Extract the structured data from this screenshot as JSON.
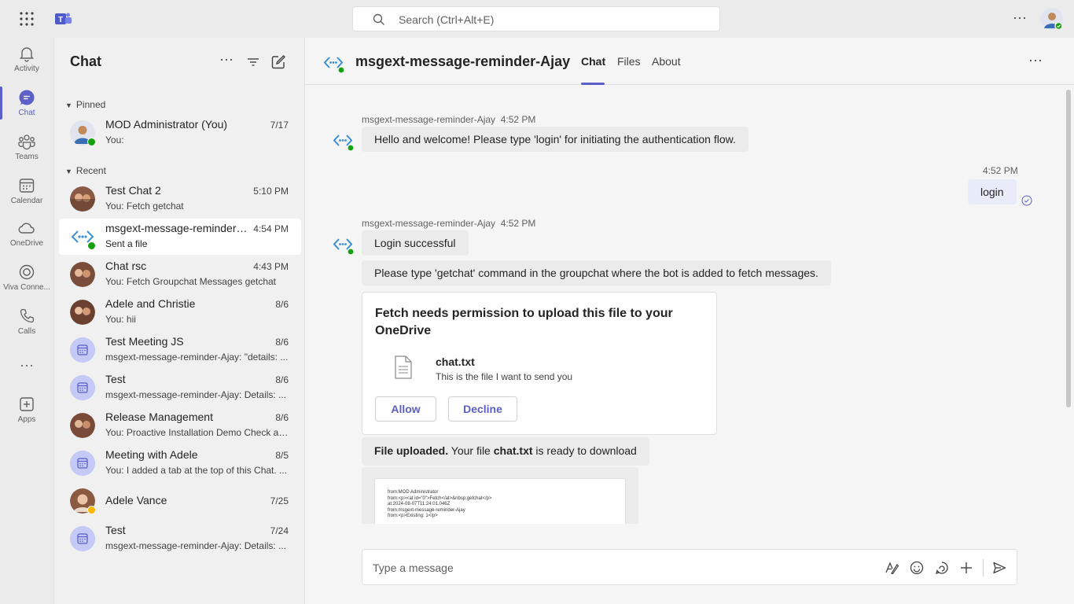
{
  "topbar": {
    "search_placeholder": "Search (Ctrl+Alt+E)",
    "more_label": "···"
  },
  "rail": {
    "items": [
      {
        "label": "Activity",
        "icon": "bell-icon"
      },
      {
        "label": "Chat",
        "icon": "chat-icon",
        "active": true
      },
      {
        "label": "Teams",
        "icon": "teams-icon"
      },
      {
        "label": "Calendar",
        "icon": "calendar-icon"
      },
      {
        "label": "OneDrive",
        "icon": "cloud-icon"
      },
      {
        "label": "Viva Conne...",
        "icon": "viva-connections-icon"
      },
      {
        "label": "Calls",
        "icon": "phone-icon"
      },
      {
        "label": "Apps",
        "icon": "apps-icon"
      }
    ],
    "more_label": "···"
  },
  "chatpane": {
    "title": "Chat",
    "pinned_label": "Pinned",
    "recent_label": "Recent",
    "pinned": [
      {
        "name": "MOD Administrator (You)",
        "time": "7/17",
        "preview": "You:"
      }
    ],
    "recent": [
      {
        "name": "Test Chat 2",
        "time": "5:10 PM",
        "preview": "You: Fetch getchat"
      },
      {
        "name": "msgext-message-reminder-Ajay",
        "time": "4:54 PM",
        "preview": "Sent a file"
      },
      {
        "name": "Chat rsc",
        "time": "4:43 PM",
        "preview": "You: Fetch Groupchat Messages getchat"
      },
      {
        "name": "Adele and Christie",
        "time": "8/6",
        "preview": "You: hii"
      },
      {
        "name": "Test Meeting JS",
        "time": "8/6",
        "preview": "msgext-message-reminder-Ajay: \"details: ..."
      },
      {
        "name": "Test",
        "time": "8/6",
        "preview": "msgext-message-reminder-Ajay: Details: ..."
      },
      {
        "name": "Release Management",
        "time": "8/6",
        "preview": "You: Proactive Installation Demo Check an..."
      },
      {
        "name": "Meeting with Adele",
        "time": "8/5",
        "preview": "You: I added a tab at the top of this Chat. ..."
      },
      {
        "name": "Adele Vance",
        "time": "7/25",
        "preview": ""
      },
      {
        "name": "Test",
        "time": "7/24",
        "preview": "msgext-message-reminder-Ajay: Details: ..."
      }
    ]
  },
  "main": {
    "title": "msgext-message-reminder-Ajay",
    "tabs": [
      "Chat",
      "Files",
      "About"
    ],
    "more_label": "···",
    "messages": {
      "m1": {
        "sender": "msgext-message-reminder-Ajay",
        "time": "4:52 PM",
        "text": "Hello and welcome! Please type 'login' for initiating the authentication flow."
      },
      "m2": {
        "time": "4:52 PM",
        "text": "login"
      },
      "m3": {
        "sender": "msgext-message-reminder-Ajay",
        "time": "4:52 PM",
        "text1": "Login successful",
        "text2": "Please type 'getchat' command in the groupchat where the bot is added to fetch messages."
      }
    },
    "card": {
      "title": "Fetch needs permission to upload this file to your OneDrive",
      "file_name": "chat.txt",
      "file_desc": "This is the file I want to send you",
      "allow_label": "Allow",
      "decline_label": "Decline"
    },
    "uploaded": {
      "bold1": "File uploaded.",
      "text1": " Your file ",
      "bold2": "chat.txt",
      "text2": " is ready to download"
    },
    "preview_lines": [
      "from:MOD Administrator",
      "from:<p><at id=\"0\">Fetch</at>&nbsp;getchat</p>",
      "at:2024-08-07T11:24:01.046Z",
      "from:msgext-message-reminder-Ajay",
      "from:<p>Existing: 1</p>"
    ],
    "compose_placeholder": "Type a message"
  },
  "colors": {
    "accent": "#5b5fc7",
    "presence_available": "#13a10e",
    "presence_away": "#f8b800"
  }
}
